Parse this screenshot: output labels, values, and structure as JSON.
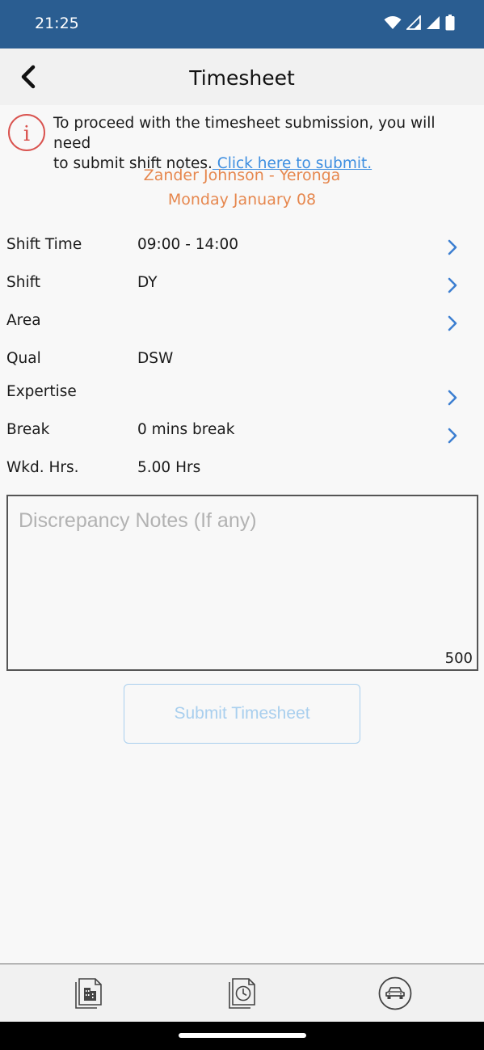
{
  "status_bar": {
    "time": "21:25",
    "icons": [
      "wifi-icon",
      "signal-icon",
      "signal-icon",
      "battery-icon"
    ]
  },
  "header": {
    "title": "Timesheet",
    "back_icon": "chevron-left-icon"
  },
  "notice": {
    "icon": "info-circle-icon",
    "text_line1": "To proceed with the timesheet submission, you will need",
    "text_line2": "to submit shift notes.",
    "link": " Click here to submit.",
    "icon_color": "#d9534f",
    "link_color": "#3d8ee0"
  },
  "shift_info": {
    "worker": "Zander Johnson - Yeronga",
    "date": "Monday January 08",
    "accent_color": "#e6874e"
  },
  "details": {
    "rows": [
      {
        "label": "Shift Time",
        "value": "09:00 - 14:00",
        "has_chevron": true
      },
      {
        "label": "Shift",
        "value": "DY",
        "has_chevron": true
      },
      {
        "label": "Area",
        "value": "",
        "has_chevron": true
      },
      {
        "label": "Qual",
        "value": "DSW",
        "has_chevron": false
      },
      {
        "label": "Expertise",
        "value": "",
        "has_chevron": true
      },
      {
        "label": "Break",
        "value": "0 mins break",
        "has_chevron": true
      },
      {
        "label": "Wkd. Hrs.",
        "value": "5.00 Hrs",
        "has_chevron": false
      }
    ]
  },
  "notes": {
    "placeholder": "Discrepancy Notes (If any)",
    "value": "",
    "char_remaining": "500"
  },
  "submit": {
    "label": "Submit Timesheet"
  },
  "bottom_nav": {
    "items": [
      {
        "icon": "building-document-icon"
      },
      {
        "icon": "clock-document-icon"
      },
      {
        "icon": "car-circle-icon"
      }
    ]
  },
  "theme": {
    "primary": "#2a5d91",
    "chevron": "#3d7fd1"
  }
}
